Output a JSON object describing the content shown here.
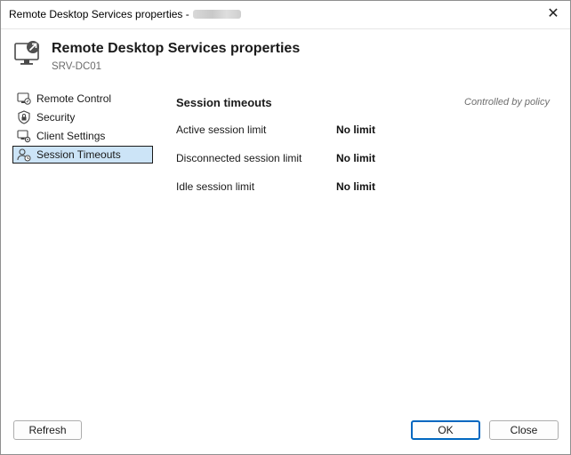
{
  "window": {
    "title": "Remote Desktop Services properties -",
    "title_obscured_suffix": "[redacted]",
    "close_glyph": "✕"
  },
  "header": {
    "title": "Remote Desktop Services properties",
    "subtitle": "SRV-DC01",
    "icon": "remote-desktop-monitor-icon"
  },
  "nav": {
    "items": [
      {
        "label": "Remote Control",
        "icon": "remote-control-icon",
        "selected": false
      },
      {
        "label": "Security",
        "icon": "security-lock-icon",
        "selected": false
      },
      {
        "label": "Client Settings",
        "icon": "client-settings-icon",
        "selected": false
      },
      {
        "label": "Session Timeouts",
        "icon": "session-timeouts-icon",
        "selected": true
      }
    ]
  },
  "panel": {
    "title": "Session timeouts",
    "policy_note": "Controlled by policy",
    "rows": [
      {
        "label": "Active session limit",
        "value": "No limit"
      },
      {
        "label": "Disconnected session limit",
        "value": "No limit"
      },
      {
        "label": "Idle session limit",
        "value": "No limit"
      }
    ]
  },
  "buttons": {
    "refresh": "Refresh",
    "ok": "OK",
    "close": "Close"
  },
  "colors": {
    "selection_bg": "#cce4f7",
    "primary_button_border": "#0067c0",
    "subtle_text": "#6b6b6b"
  }
}
